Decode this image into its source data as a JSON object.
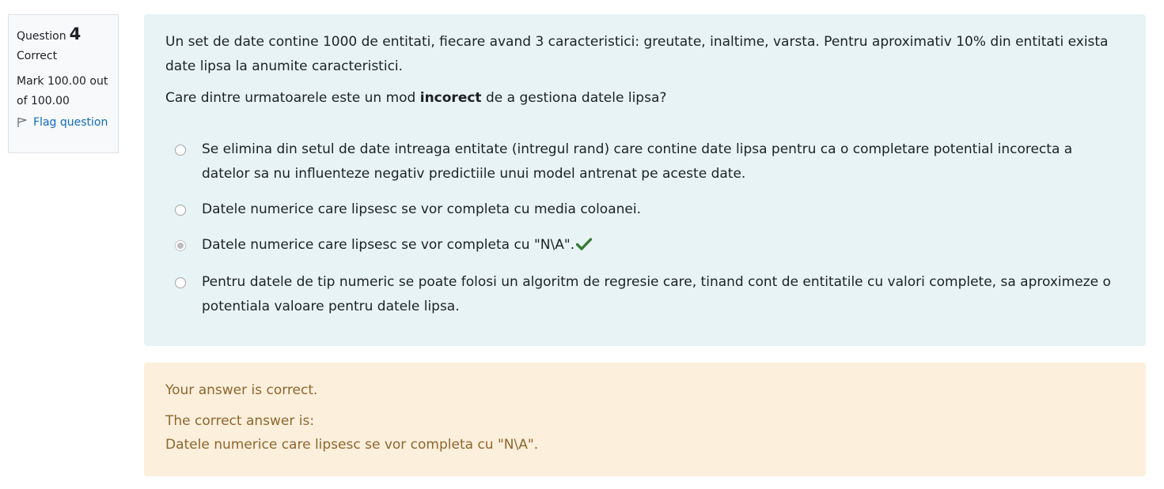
{
  "info": {
    "question_label": "Question",
    "question_number": "4",
    "state": "Correct",
    "grade": "Mark 100.00 out of 100.00",
    "flag_label": "Flag question"
  },
  "question": {
    "text_p1": "Un set de date contine 1000 de entitati, fiecare avand 3 caracteristici: greutate, inaltime, varsta. Pentru aproximativ 10% din entitati exista date lipsa la anumite caracteristici.",
    "prompt_before": "Care dintre urmatoarele este un mod ",
    "prompt_bold": "incorect",
    "prompt_after": " de a gestiona datele lipsa?",
    "answers": [
      {
        "text": "Se elimina din setul de date intreaga entitate (intregul rand) care contine date lipsa pentru ca o completare potential incorecta a datelor sa nu influenteze negativ predictiile unui model antrenat pe aceste date.",
        "selected": false
      },
      {
        "text": "Datele numerice care lipsesc se vor completa cu media coloanei.",
        "selected": false
      },
      {
        "text": "Datele numerice care lipsesc se vor completa cu \"N\\A\".",
        "selected": true
      },
      {
        "text": "Pentru datele de tip numeric se poate folosi un algoritm de regresie care, tinand cont de entitatile cu valori complete, sa aproximeze o potentiala valoare pentru datele lipsa.",
        "selected": false
      }
    ],
    "check_icon": "check-icon"
  },
  "outcome": {
    "feedback": "Your answer is correct.",
    "right_answer_label": "The correct answer is:",
    "right_answer": "Datele numerice care lipsesc se vor completa cu \"N\\A\"."
  },
  "colors": {
    "formulation_bg": "#e7f3f5",
    "outcome_bg": "#fcefdc",
    "outcome_text": "#8e662e",
    "correct_green": "#357a32",
    "link": "#0f6cbf"
  }
}
